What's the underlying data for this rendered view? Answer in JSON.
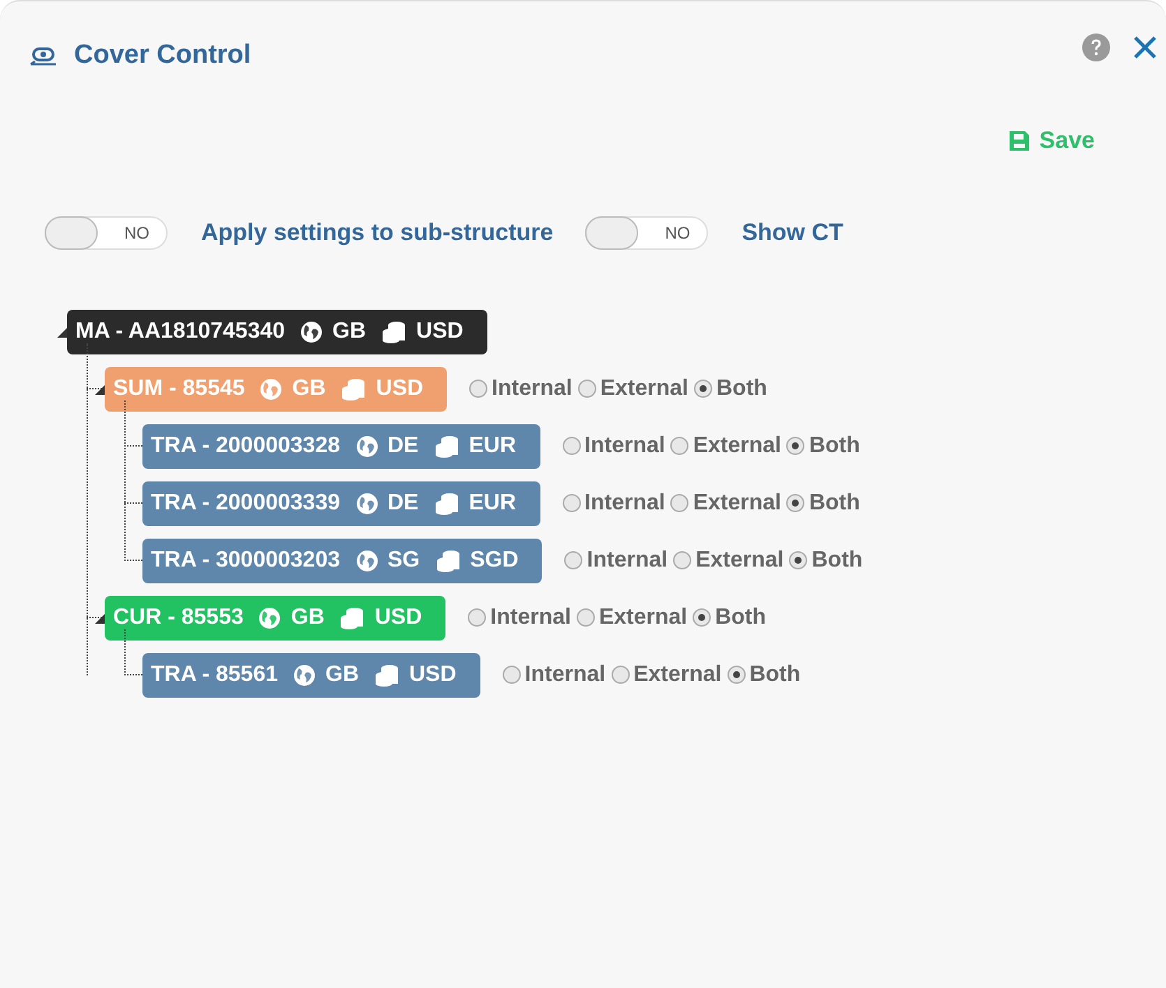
{
  "window": {
    "title": "Cover Control"
  },
  "save_button": "Save",
  "toggles": [
    {
      "state_text": "NO",
      "on": false,
      "label": "Apply settings to sub-structure"
    },
    {
      "state_text": "NO",
      "on": false,
      "label": "Show CT"
    }
  ],
  "tree": [
    {
      "kind": "ma",
      "label": "MA - AA1810745340",
      "country": "GB",
      "currency": "USD",
      "expanded": true,
      "children": [
        {
          "kind": "sum",
          "label": "SUM - 85545",
          "country": "GB",
          "currency": "USD",
          "expanded": true,
          "options": [
            {
              "label": "Internal",
              "selected": false
            },
            {
              "label": "External",
              "selected": false
            },
            {
              "label": "Both",
              "selected": true
            }
          ],
          "children": [
            {
              "kind": "tra",
              "label": "TRA - 2000003328",
              "country": "DE",
              "currency": "EUR",
              "options": [
                {
                  "label": "Internal",
                  "selected": false
                },
                {
                  "label": "External",
                  "selected": false
                },
                {
                  "label": "Both",
                  "selected": true
                }
              ]
            },
            {
              "kind": "tra",
              "label": "TRA - 2000003339",
              "country": "DE",
              "currency": "EUR",
              "options": [
                {
                  "label": "Internal",
                  "selected": false
                },
                {
                  "label": "External",
                  "selected": false
                },
                {
                  "label": "Both",
                  "selected": true
                }
              ]
            },
            {
              "kind": "tra",
              "label": "TRA - 3000003203",
              "country": "SG",
              "currency": "SGD",
              "options": [
                {
                  "label": "Internal",
                  "selected": false
                },
                {
                  "label": "External",
                  "selected": false
                },
                {
                  "label": "Both",
                  "selected": true
                }
              ]
            }
          ]
        },
        {
          "kind": "cur",
          "label": "CUR - 85553",
          "country": "GB",
          "currency": "USD",
          "expanded": true,
          "options": [
            {
              "label": "Internal",
              "selected": false
            },
            {
              "label": "External",
              "selected": false
            },
            {
              "label": "Both",
              "selected": true
            }
          ],
          "children": [
            {
              "kind": "tra",
              "label": "TRA - 85561",
              "country": "GB",
              "currency": "USD",
              "options": [
                {
                  "label": "Internal",
                  "selected": false
                },
                {
                  "label": "External",
                  "selected": false
                },
                {
                  "label": "Both",
                  "selected": true
                }
              ]
            }
          ]
        }
      ]
    }
  ]
}
